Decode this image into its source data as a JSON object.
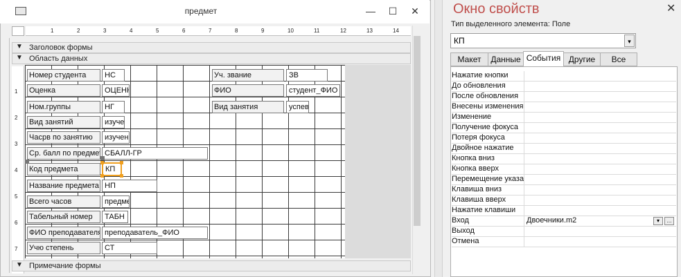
{
  "form": {
    "title": "предмет",
    "window_controls": {
      "minimize": "—",
      "maximize": "☐",
      "close": "✕"
    },
    "ruler_ticks": [
      "1",
      "2",
      "3",
      "4",
      "5",
      "6",
      "7",
      "8",
      "9",
      "10",
      "11",
      "12",
      "13",
      "14"
    ],
    "vruler_ticks": [
      "1",
      "2",
      "3",
      "4",
      "5",
      "6",
      "7"
    ],
    "sections": {
      "header": "Заголовок формы",
      "detail": "Область данных",
      "footer": "Примечание формы"
    },
    "controls": [
      {
        "label": "Номер студента",
        "field": "НС"
      },
      {
        "label": "Оценка",
        "field": "ОЦЕНК"
      },
      {
        "label": "Ном.группы",
        "field": "НГ"
      },
      {
        "label": "Вид занятий",
        "field": "изуче"
      },
      {
        "label": "Часрв по занятию",
        "field": "изучен"
      },
      {
        "label": "Ср. балл по предмет",
        "field": "СБАЛЛ-ГР"
      },
      {
        "label": "Код предмета",
        "field": "КП"
      },
      {
        "label": "Название предмета",
        "field": "НП"
      },
      {
        "label": "Всего часов",
        "field": "предме"
      },
      {
        "label": "Табельный номер",
        "field": "ТАБН"
      },
      {
        "label": "ФИО преподавателя",
        "field": "преподаватель_ФИО"
      },
      {
        "label": "Учю степень",
        "field": "СТ"
      }
    ],
    "right_controls": [
      {
        "label": "Уч. звание",
        "field": "ЗВ"
      },
      {
        "label": "ФИО",
        "field": "студент_ФИО"
      },
      {
        "label": "Вид занятия",
        "field": "успев"
      }
    ]
  },
  "properties": {
    "title": "Окно свойств",
    "close": "✕",
    "selection_type": "Тип выделенного элемента:  Поле",
    "selected": "КП",
    "tabs": [
      "Макет",
      "Данные",
      "События",
      "Другие",
      "Все"
    ],
    "active_tab": "События",
    "rows": [
      {
        "name": "Нажатие кнопки",
        "value": ""
      },
      {
        "name": "До обновления",
        "value": ""
      },
      {
        "name": "После обновления",
        "value": ""
      },
      {
        "name": "Внесены изменения",
        "value": ""
      },
      {
        "name": "Изменение",
        "value": ""
      },
      {
        "name": "Получение фокуса",
        "value": ""
      },
      {
        "name": "Потеря фокуса",
        "value": ""
      },
      {
        "name": "Двойное нажатие",
        "value": ""
      },
      {
        "name": "Кнопка вниз",
        "value": ""
      },
      {
        "name": "Кнопка вверх",
        "value": ""
      },
      {
        "name": "Перемещение указателя",
        "value": ""
      },
      {
        "name": "Клавиша вниз",
        "value": ""
      },
      {
        "name": "Клавиша вверх",
        "value": ""
      },
      {
        "name": "Нажатие клавиши",
        "value": ""
      },
      {
        "name": "Вход",
        "value": "Двоечники.m2"
      },
      {
        "name": "Выход",
        "value": ""
      },
      {
        "name": "Отмена",
        "value": ""
      }
    ],
    "builder_button": "...",
    "dropdown_button": "▾"
  },
  "colors": {
    "title_accent": "#c0504d",
    "selection": "#f0a020"
  }
}
